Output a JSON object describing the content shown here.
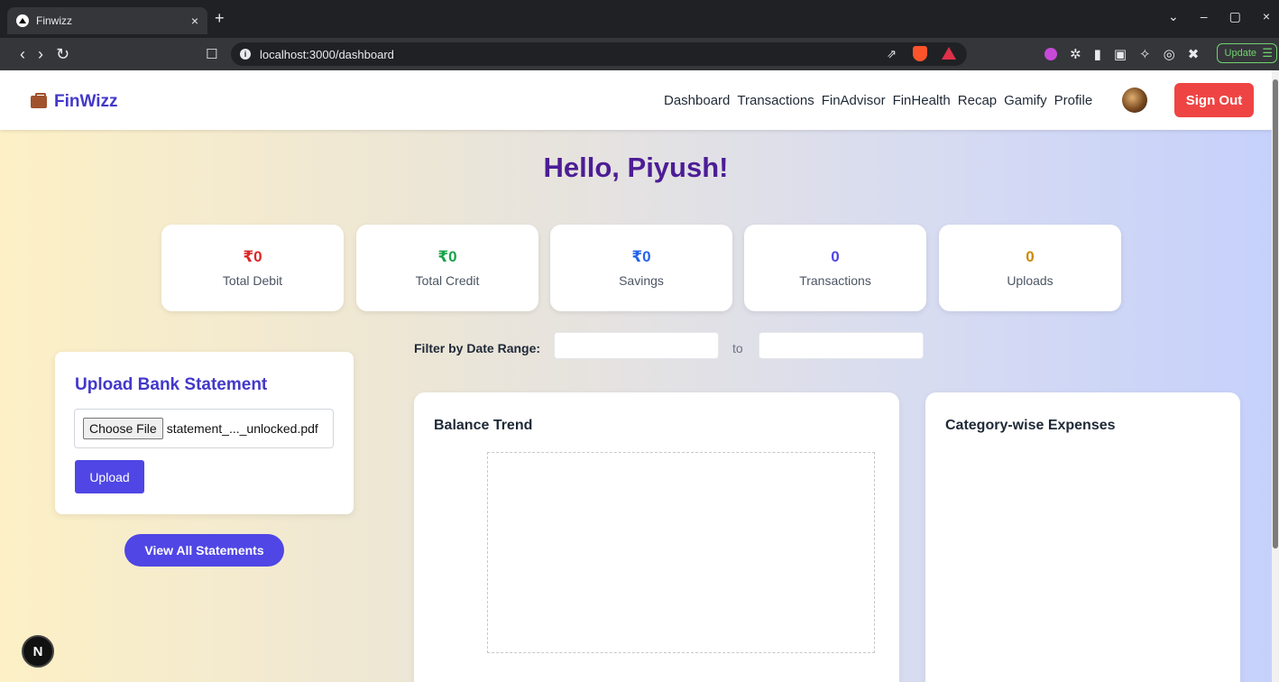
{
  "browser": {
    "tab_title": "Finwizz",
    "tab_close": "×",
    "new_tab": "+",
    "url": "localhost:3000/dashboard",
    "update_label": "Update",
    "window_controls": [
      "⌄",
      "–",
      "▢",
      "×"
    ]
  },
  "navbar": {
    "brand": "FinWizz",
    "links": [
      "Dashboard",
      "Transactions",
      "FinAdvisor",
      "FinHealth",
      "Recap",
      "Gamify",
      "Profile"
    ],
    "sign_out": "Sign Out"
  },
  "greeting": "Hello, Piyush!",
  "stats": [
    {
      "value": "₹0",
      "label": "Total Debit",
      "color": "#dc2626"
    },
    {
      "value": "₹0",
      "label": "Total Credit",
      "color": "#16a34a"
    },
    {
      "value": "₹0",
      "label": "Savings",
      "color": "#2563eb"
    },
    {
      "value": "0",
      "label": "Transactions",
      "color": "#4f46e5"
    },
    {
      "value": "0",
      "label": "Uploads",
      "color": "#ca8a04"
    }
  ],
  "filter": {
    "label": "Filter by Date Range:",
    "to": "to",
    "start_value": "",
    "end_value": ""
  },
  "upload": {
    "title": "Upload Bank Statement",
    "choose_file": "Choose File",
    "file_name": "statement_..._unlocked.pdf",
    "upload_button": "Upload"
  },
  "view_all": "View All Statements",
  "charts": {
    "balance_title": "Balance Trend",
    "category_title": "Category-wise Expenses"
  },
  "dev_badge": "N"
}
